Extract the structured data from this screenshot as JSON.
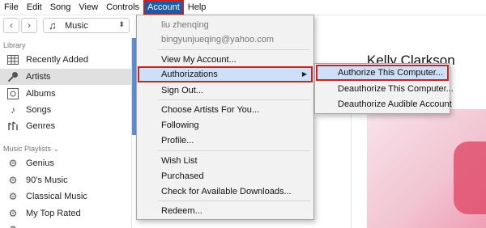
{
  "menubar": {
    "items": [
      "File",
      "Edit",
      "Song",
      "View",
      "Controls",
      "Account",
      "Help"
    ]
  },
  "toolbar": {
    "back_glyph": "‹",
    "forward_glyph": "›",
    "media_kind": "Music"
  },
  "sidebar": {
    "library_header": "Library",
    "library_items": [
      {
        "label": "Recently Added",
        "icon": "grid-icon"
      },
      {
        "label": "Artists",
        "icon": "microphone-icon"
      },
      {
        "label": "Albums",
        "icon": "album-icon"
      },
      {
        "label": "Songs",
        "icon": "music-note-icon"
      },
      {
        "label": "Genres",
        "icon": "genres-icon"
      }
    ],
    "playlists_header": "Music Playlists ⌄",
    "playlist_items": [
      {
        "label": "Genius",
        "icon": "gear-icon"
      },
      {
        "label": "90's Music",
        "icon": "gear-icon"
      },
      {
        "label": "Classical Music",
        "icon": "gear-icon"
      },
      {
        "label": "My Top Rated",
        "icon": "gear-icon"
      }
    ]
  },
  "main": {
    "artist_name": "Kelly Clarkson"
  },
  "account_menu": {
    "user_name": "liu zhenqing",
    "user_email": "bingyunjueqing@yahoo.com",
    "items_group1": [
      "View My Account...",
      "Authorizations",
      "Sign Out..."
    ],
    "items_group2": [
      "Choose Artists For You...",
      "Following",
      "Profile..."
    ],
    "items_group3": [
      "Wish List",
      "Purchased",
      "Check for Available Downloads..."
    ],
    "items_group4": [
      "Redeem..."
    ]
  },
  "authorizations_submenu": {
    "items": [
      "Authorize This Computer...",
      "Deauthorize This Computer...",
      "Deauthorize Audible Account"
    ]
  },
  "colors": {
    "menu_active": "#1e5aa8",
    "highlight_box": "#d01f1f",
    "hover_row": "#cde0f7"
  }
}
